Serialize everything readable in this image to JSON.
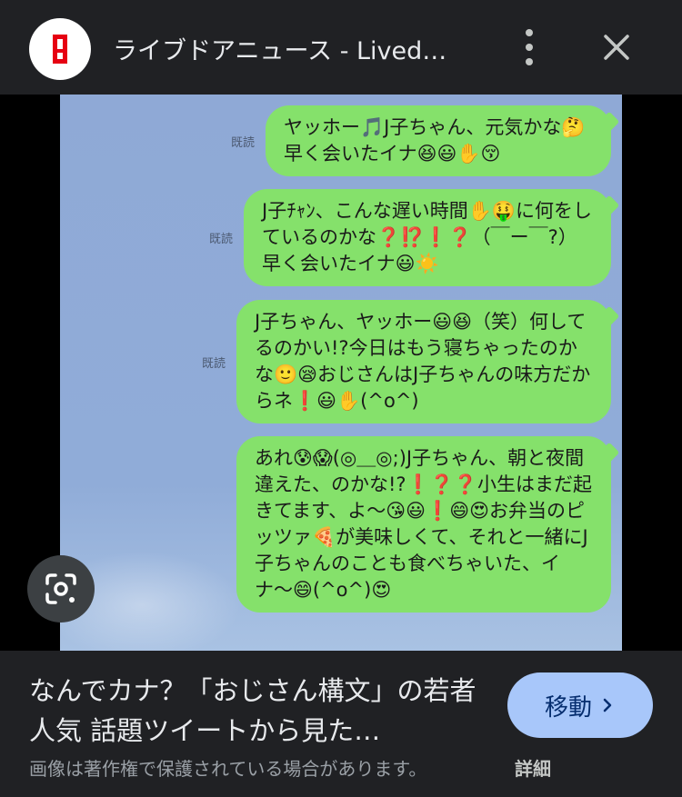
{
  "header": {
    "site_title": "ライブドアニュース - Lived…",
    "site_icon": "livedoor-news-logo",
    "more_icon": "more-vert-icon",
    "close_icon": "close-icon"
  },
  "image": {
    "messages": [
      {
        "read": "既読",
        "text": "ヤッホー🎵J子ちゃん、元気かな🤔早く会いたイナ😆😃✋😚"
      },
      {
        "read": "既読",
        "text": "J子ﾁｬﾝ、こんな遅い時間✋🤑に何をしているのかな❓⁉️❗❓（￣ー￣?）早く会いたイナ😃☀️"
      },
      {
        "read": "既読",
        "text": "J子ちゃん、ヤッホー😃😆（笑）何してるのかい!?今日はもう寝ちゃったのかな🙂😪おじさんはJ子ちゃんの味方だからネ❗😃✋(^o^)"
      },
      {
        "read": "",
        "text": "あれ😰😱(◎＿◎;)J子ちゃん、朝と夜間違えた、のかな!?❗❓❓小生はまだ起きてます、よ〜😘😃❗😄😍お弁当のピッツァ🍕が美味しくて、それと一緒にJ子ちゃんのことも食べちゃいた、イナ〜😄(^o^)😍"
      }
    ],
    "lens_icon": "google-lens-icon"
  },
  "caption": {
    "title": "なんでカナ？「おじさん構文」の若者人気 話題ツイートから見た…",
    "visit_label": "移動",
    "copyright": "画像は著作権で保護されている場合があります。",
    "details_label": "詳細"
  },
  "colors": {
    "background": "#202124",
    "chat_background": "#8fa9d6",
    "bubble": "#85e16b",
    "visit_button": "#a8c7fa",
    "logo_red": "#e60012"
  }
}
